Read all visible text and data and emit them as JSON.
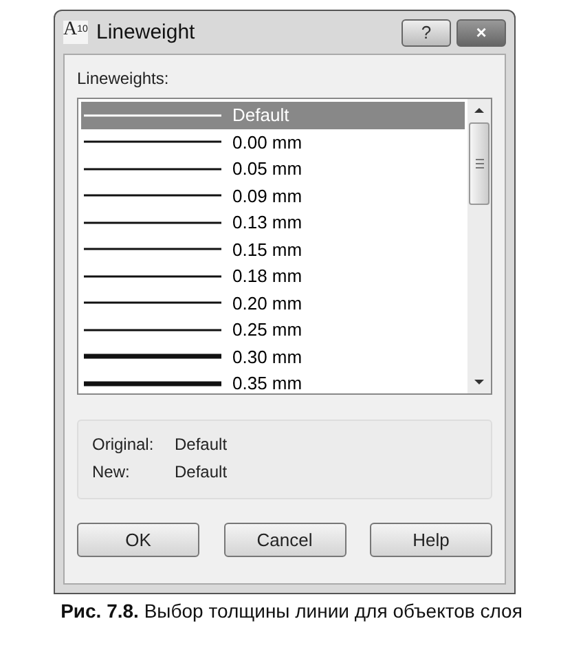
{
  "window": {
    "icon_letter": "A",
    "icon_sub": "10",
    "title": "Lineweight",
    "help_button": "?",
    "close_button": "×"
  },
  "list_label": "Lineweights:",
  "lineweights": [
    {
      "label": "Default",
      "kind": "thin",
      "selected": true
    },
    {
      "label": "0.00 mm",
      "kind": "thin",
      "selected": false
    },
    {
      "label": "0.05 mm",
      "kind": "thin",
      "selected": false
    },
    {
      "label": "0.09 mm",
      "kind": "thin",
      "selected": false
    },
    {
      "label": "0.13 mm",
      "kind": "thin",
      "selected": false
    },
    {
      "label": "0.15 mm",
      "kind": "thin",
      "selected": false
    },
    {
      "label": "0.18 mm",
      "kind": "thin",
      "selected": false
    },
    {
      "label": "0.20 mm",
      "kind": "thin",
      "selected": false
    },
    {
      "label": "0.25 mm",
      "kind": "thin",
      "selected": false
    },
    {
      "label": "0.30 mm",
      "kind": "thick",
      "selected": false
    },
    {
      "label": "0.35 mm",
      "kind": "thick",
      "selected": false
    }
  ],
  "info": [
    {
      "label": "Original:",
      "value": "Default"
    },
    {
      "label": "New:",
      "value": "Default"
    }
  ],
  "buttons": [
    "OK",
    "Cancel",
    "Help"
  ],
  "caption": "**Рис. 7.8.** Выбор толщины линии для объектов слоя"
}
